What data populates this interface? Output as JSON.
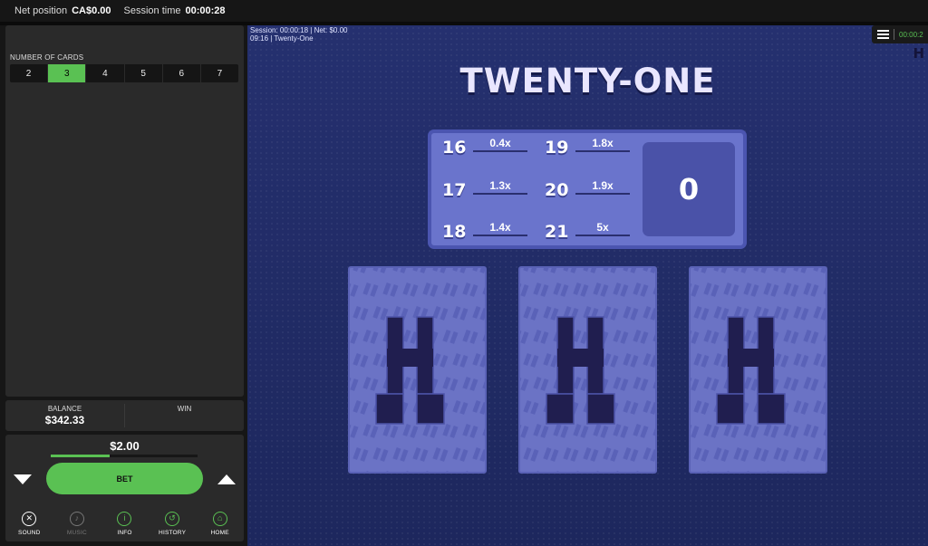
{
  "topbar": {
    "net_label": "Net position",
    "net_value": "CA$0.00",
    "session_label": "Session time",
    "session_value": "00:00:28"
  },
  "left_panel": {
    "cards_label": "NUMBER OF CARDS",
    "card_options": [
      "2",
      "3",
      "4",
      "5",
      "6",
      "7"
    ],
    "selected_card_option": "3",
    "balance_label": "BALANCE",
    "balance_value": "$342.33",
    "win_label": "WIN",
    "win_value": "",
    "bet_amount": "$2.00",
    "bet_level_fraction": 0.4,
    "bet_label": "BET"
  },
  "nav": [
    {
      "label": "SOUND",
      "icon": "speaker-muted-icon",
      "glyph": "✕",
      "state": "active"
    },
    {
      "label": "MUSIC",
      "icon": "music-note-icon",
      "glyph": "♪",
      "state": "dim"
    },
    {
      "label": "INFO",
      "icon": "info-icon",
      "glyph": "i",
      "state": "green"
    },
    {
      "label": "HISTORY",
      "icon": "history-icon",
      "glyph": "↺",
      "state": "green"
    },
    {
      "label": "HOME",
      "icon": "home-icon",
      "glyph": "⌂",
      "state": "green"
    }
  ],
  "game": {
    "session_line1": "Session: 00:00:18 | Net: $0.00",
    "session_line2": "09:16 | Twenty-One",
    "menu_time": "00:00:2",
    "title": "TWENTY-ONE",
    "paytable": [
      {
        "total": "16",
        "multiplier": "0.4x"
      },
      {
        "total": "17",
        "multiplier": "1.3x"
      },
      {
        "total": "18",
        "multiplier": "1.4x"
      },
      {
        "total": "19",
        "multiplier": "1.8x"
      },
      {
        "total": "20",
        "multiplier": "1.9x"
      },
      {
        "total": "21",
        "multiplier": "5x"
      }
    ],
    "current_total": "0",
    "card_count": 3
  },
  "colors": {
    "accent_green": "#5ac153",
    "game_bg": "#1f2961",
    "paytable_bg": "#6a74cc",
    "card_bg": "#6b73c5",
    "card_logo": "#201e4f"
  }
}
